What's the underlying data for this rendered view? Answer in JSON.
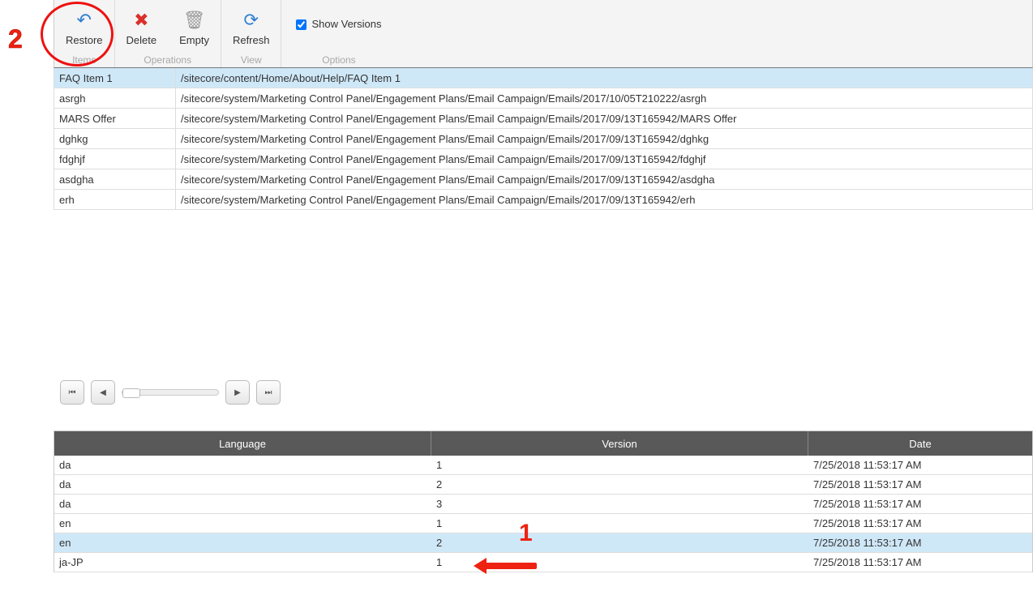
{
  "toolbar": {
    "groups": [
      {
        "label": "Items",
        "buttons": [
          {
            "id": "restore-button",
            "icon": "restore-icon",
            "glyph": "↶",
            "label": "Restore",
            "cls": "icon-restore"
          }
        ]
      },
      {
        "label": "Operations",
        "buttons": [
          {
            "id": "delete-button",
            "icon": "delete-icon",
            "glyph": "✖",
            "label": "Delete",
            "cls": "icon-delete"
          },
          {
            "id": "empty-button",
            "icon": "empty-icon",
            "glyph": "🗑",
            "label": "Empty",
            "cls": "icon-empty"
          }
        ]
      },
      {
        "label": "View",
        "buttons": [
          {
            "id": "refresh-button",
            "icon": "refresh-icon",
            "glyph": "⟳",
            "label": "Refresh",
            "cls": "icon-refresh"
          }
        ]
      }
    ],
    "options": {
      "show_versions_label": "Show Versions",
      "group_label": "Options",
      "checked": true
    }
  },
  "items": [
    {
      "name": "FAQ Item 1",
      "path": "/sitecore/content/Home/About/Help/FAQ Item 1",
      "selected": true
    },
    {
      "name": "asrgh",
      "path": "/sitecore/system/Marketing Control Panel/Engagement Plans/Email Campaign/Emails/2017/10/05T210222/asrgh",
      "selected": false
    },
    {
      "name": "MARS Offer",
      "path": "/sitecore/system/Marketing Control Panel/Engagement Plans/Email Campaign/Emails/2017/09/13T165942/MARS Offer",
      "selected": false
    },
    {
      "name": "dghkg",
      "path": "/sitecore/system/Marketing Control Panel/Engagement Plans/Email Campaign/Emails/2017/09/13T165942/dghkg",
      "selected": false
    },
    {
      "name": "fdghjf",
      "path": "/sitecore/system/Marketing Control Panel/Engagement Plans/Email Campaign/Emails/2017/09/13T165942/fdghjf",
      "selected": false
    },
    {
      "name": "asdgha",
      "path": "/sitecore/system/Marketing Control Panel/Engagement Plans/Email Campaign/Emails/2017/09/13T165942/asdgha",
      "selected": false
    },
    {
      "name": "erh",
      "path": "/sitecore/system/Marketing Control Panel/Engagement Plans/Email Campaign/Emails/2017/09/13T165942/erh",
      "selected": false
    }
  ],
  "pager": {
    "first": "⏮",
    "prev": "◀",
    "next": "▶",
    "last": "⏭"
  },
  "versions": {
    "headers": {
      "language": "Language",
      "version": "Version",
      "date": "Date"
    },
    "rows": [
      {
        "language": "da",
        "version": "1",
        "date": "7/25/2018 11:53:17 AM",
        "highlighted": false
      },
      {
        "language": "da",
        "version": "2",
        "date": "7/25/2018 11:53:17 AM",
        "highlighted": false
      },
      {
        "language": "da",
        "version": "3",
        "date": "7/25/2018 11:53:17 AM",
        "highlighted": false
      },
      {
        "language": "en",
        "version": "1",
        "date": "7/25/2018 11:53:17 AM",
        "highlighted": false
      },
      {
        "language": "en",
        "version": "2",
        "date": "7/25/2018 11:53:17 AM",
        "highlighted": true
      },
      {
        "language": "ja-JP",
        "version": "1",
        "date": "7/25/2018 11:53:17 AM",
        "highlighted": false
      }
    ]
  },
  "annotations": {
    "step1": "1",
    "step2": "2"
  }
}
